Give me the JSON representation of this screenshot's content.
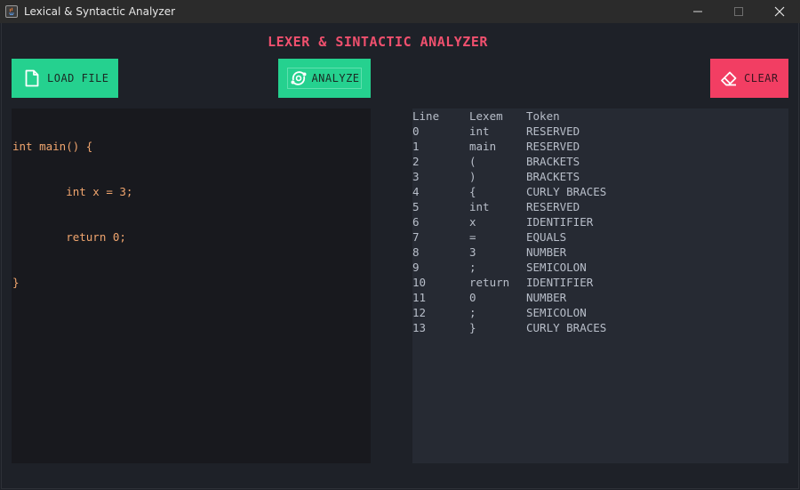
{
  "window": {
    "title": "Lexical & Syntactic Analyzer",
    "controls": [
      "minimize",
      "maximize",
      "close"
    ]
  },
  "app": {
    "title": "LEXER & SINTACTIC ANALYZER"
  },
  "buttons": {
    "load": {
      "label": "LOAD FILE",
      "icon": "file-icon"
    },
    "analyze": {
      "label": "ANALYZE",
      "icon": "analyze-icon"
    },
    "clear": {
      "label": "CLEAR",
      "icon": "eraser-icon"
    }
  },
  "editor": {
    "lines": [
      "int main() {",
      "        int x = 3;",
      "        return 0;",
      "}"
    ]
  },
  "output": {
    "headers": {
      "line": "Line",
      "lexem": "Lexem",
      "token": "Token"
    },
    "rows": [
      {
        "line": "0",
        "lexem": "int",
        "token": "RESERVED"
      },
      {
        "line": "1",
        "lexem": "main",
        "token": "RESERVED"
      },
      {
        "line": "2",
        "lexem": "(",
        "token": "BRACKETS"
      },
      {
        "line": "3",
        "lexem": ")",
        "token": "BRACKETS"
      },
      {
        "line": "4",
        "lexem": "{",
        "token": "CURLY BRACES"
      },
      {
        "line": "5",
        "lexem": "int",
        "token": "RESERVED"
      },
      {
        "line": "6",
        "lexem": "x",
        "token": "IDENTIFIER"
      },
      {
        "line": "7",
        "lexem": "=",
        "token": "EQUALS"
      },
      {
        "line": "8",
        "lexem": "3",
        "token": "NUMBER"
      },
      {
        "line": "9",
        "lexem": ";",
        "token": "SEMICOLON"
      },
      {
        "line": "10",
        "lexem": "return",
        "token": "IDENTIFIER"
      },
      {
        "line": "11",
        "lexem": "0",
        "token": "NUMBER"
      },
      {
        "line": "12",
        "lexem": ";",
        "token": "SEMICOLON"
      },
      {
        "line": "13",
        "lexem": "}",
        "token": "CURLY BRACES"
      }
    ]
  },
  "colors": {
    "accent_green": "#25d18f",
    "accent_red": "#f23e63",
    "title_pink": "#f0506e",
    "code_orange": "#f0a56e",
    "background": "#1e2128"
  }
}
